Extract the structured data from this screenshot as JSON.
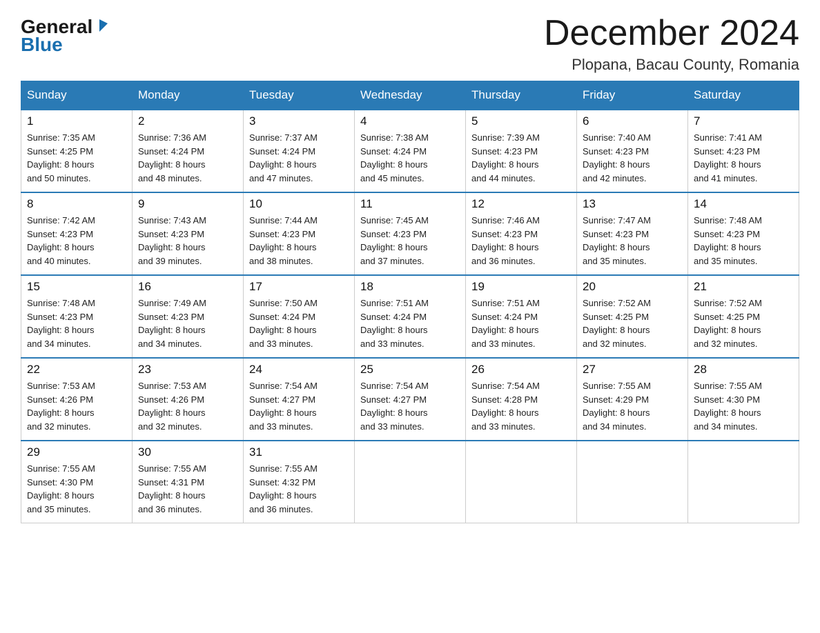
{
  "logo": {
    "general": "General",
    "blue": "Blue"
  },
  "header": {
    "month": "December 2024",
    "location": "Plopana, Bacau County, Romania"
  },
  "weekdays": [
    "Sunday",
    "Monday",
    "Tuesday",
    "Wednesday",
    "Thursday",
    "Friday",
    "Saturday"
  ],
  "weeks": [
    [
      {
        "day": "1",
        "sunrise": "7:35 AM",
        "sunset": "4:25 PM",
        "daylight": "8 hours and 50 minutes."
      },
      {
        "day": "2",
        "sunrise": "7:36 AM",
        "sunset": "4:24 PM",
        "daylight": "8 hours and 48 minutes."
      },
      {
        "day": "3",
        "sunrise": "7:37 AM",
        "sunset": "4:24 PM",
        "daylight": "8 hours and 47 minutes."
      },
      {
        "day": "4",
        "sunrise": "7:38 AM",
        "sunset": "4:24 PM",
        "daylight": "8 hours and 45 minutes."
      },
      {
        "day": "5",
        "sunrise": "7:39 AM",
        "sunset": "4:23 PM",
        "daylight": "8 hours and 44 minutes."
      },
      {
        "day": "6",
        "sunrise": "7:40 AM",
        "sunset": "4:23 PM",
        "daylight": "8 hours and 42 minutes."
      },
      {
        "day": "7",
        "sunrise": "7:41 AM",
        "sunset": "4:23 PM",
        "daylight": "8 hours and 41 minutes."
      }
    ],
    [
      {
        "day": "8",
        "sunrise": "7:42 AM",
        "sunset": "4:23 PM",
        "daylight": "8 hours and 40 minutes."
      },
      {
        "day": "9",
        "sunrise": "7:43 AM",
        "sunset": "4:23 PM",
        "daylight": "8 hours and 39 minutes."
      },
      {
        "day": "10",
        "sunrise": "7:44 AM",
        "sunset": "4:23 PM",
        "daylight": "8 hours and 38 minutes."
      },
      {
        "day": "11",
        "sunrise": "7:45 AM",
        "sunset": "4:23 PM",
        "daylight": "8 hours and 37 minutes."
      },
      {
        "day": "12",
        "sunrise": "7:46 AM",
        "sunset": "4:23 PM",
        "daylight": "8 hours and 36 minutes."
      },
      {
        "day": "13",
        "sunrise": "7:47 AM",
        "sunset": "4:23 PM",
        "daylight": "8 hours and 35 minutes."
      },
      {
        "day": "14",
        "sunrise": "7:48 AM",
        "sunset": "4:23 PM",
        "daylight": "8 hours and 35 minutes."
      }
    ],
    [
      {
        "day": "15",
        "sunrise": "7:48 AM",
        "sunset": "4:23 PM",
        "daylight": "8 hours and 34 minutes."
      },
      {
        "day": "16",
        "sunrise": "7:49 AM",
        "sunset": "4:23 PM",
        "daylight": "8 hours and 34 minutes."
      },
      {
        "day": "17",
        "sunrise": "7:50 AM",
        "sunset": "4:24 PM",
        "daylight": "8 hours and 33 minutes."
      },
      {
        "day": "18",
        "sunrise": "7:51 AM",
        "sunset": "4:24 PM",
        "daylight": "8 hours and 33 minutes."
      },
      {
        "day": "19",
        "sunrise": "7:51 AM",
        "sunset": "4:24 PM",
        "daylight": "8 hours and 33 minutes."
      },
      {
        "day": "20",
        "sunrise": "7:52 AM",
        "sunset": "4:25 PM",
        "daylight": "8 hours and 32 minutes."
      },
      {
        "day": "21",
        "sunrise": "7:52 AM",
        "sunset": "4:25 PM",
        "daylight": "8 hours and 32 minutes."
      }
    ],
    [
      {
        "day": "22",
        "sunrise": "7:53 AM",
        "sunset": "4:26 PM",
        "daylight": "8 hours and 32 minutes."
      },
      {
        "day": "23",
        "sunrise": "7:53 AM",
        "sunset": "4:26 PM",
        "daylight": "8 hours and 32 minutes."
      },
      {
        "day": "24",
        "sunrise": "7:54 AM",
        "sunset": "4:27 PM",
        "daylight": "8 hours and 33 minutes."
      },
      {
        "day": "25",
        "sunrise": "7:54 AM",
        "sunset": "4:27 PM",
        "daylight": "8 hours and 33 minutes."
      },
      {
        "day": "26",
        "sunrise": "7:54 AM",
        "sunset": "4:28 PM",
        "daylight": "8 hours and 33 minutes."
      },
      {
        "day": "27",
        "sunrise": "7:55 AM",
        "sunset": "4:29 PM",
        "daylight": "8 hours and 34 minutes."
      },
      {
        "day": "28",
        "sunrise": "7:55 AM",
        "sunset": "4:30 PM",
        "daylight": "8 hours and 34 minutes."
      }
    ],
    [
      {
        "day": "29",
        "sunrise": "7:55 AM",
        "sunset": "4:30 PM",
        "daylight": "8 hours and 35 minutes."
      },
      {
        "day": "30",
        "sunrise": "7:55 AM",
        "sunset": "4:31 PM",
        "daylight": "8 hours and 36 minutes."
      },
      {
        "day": "31",
        "sunrise": "7:55 AM",
        "sunset": "4:32 PM",
        "daylight": "8 hours and 36 minutes."
      },
      null,
      null,
      null,
      null
    ]
  ]
}
